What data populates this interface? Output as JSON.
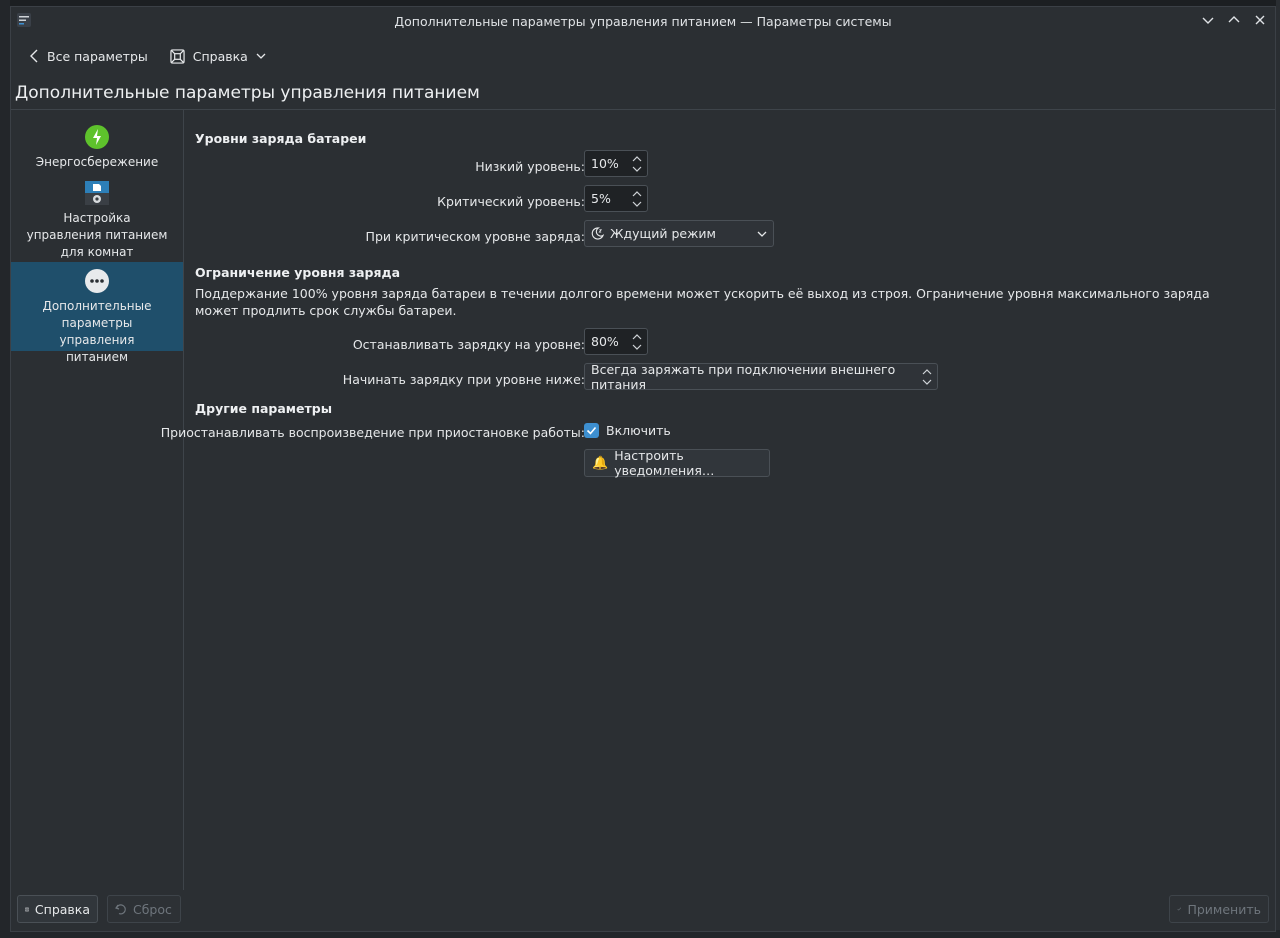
{
  "window": {
    "title": "Дополнительные параметры управления питанием — Параметры системы"
  },
  "toolbar": {
    "back_label": "Все параметры",
    "help_label": "Справка"
  },
  "page": {
    "title": "Дополнительные параметры управления питанием"
  },
  "sidebar": {
    "items": [
      {
        "label": "Энергосбережение",
        "icon": "battery-bolt-icon"
      },
      {
        "label": "Настройка управления питанием для комнат",
        "icon": "room-settings-icon"
      },
      {
        "label": "Дополнительные параметры управления питанием",
        "icon": "more-options-icon",
        "active": true
      }
    ]
  },
  "battery_levels": {
    "title": "Уровни заряда батареи",
    "low_label": "Низкий уровень:",
    "low_value": "10%",
    "critical_label": "Критический уровень:",
    "critical_value": "5%",
    "action_label": "При критическом уровне заряда:",
    "action_value": "Ждущий режим"
  },
  "charge_limit": {
    "title": "Ограничение уровня заряда",
    "description": "Поддержание 100% уровня заряда батареи в течении долгого времени может ускорить её выход из строя. Ограничение уровня максимального заряда может продлить срок службы батареи.",
    "stop_label": "Останавливать зарядку на уровне:",
    "stop_value": "80%",
    "start_label": "Начинать зарядку при уровне ниже:",
    "start_value": "Всегда заряжать при подключении внешнего питания"
  },
  "other": {
    "title": "Другие параметры",
    "pause_label": "Приостанавливать воспроизведение при приостановке работы:",
    "enable_label": "Включить",
    "notify_label": "Настроить уведомления…"
  },
  "footer": {
    "help_label": "Справка",
    "reset_label": "Сброс",
    "apply_label": "Применить"
  },
  "colors": {
    "accent": "#3d8fd0",
    "active_item": "#1f4f6b",
    "battery_green": "#5ec22c"
  }
}
